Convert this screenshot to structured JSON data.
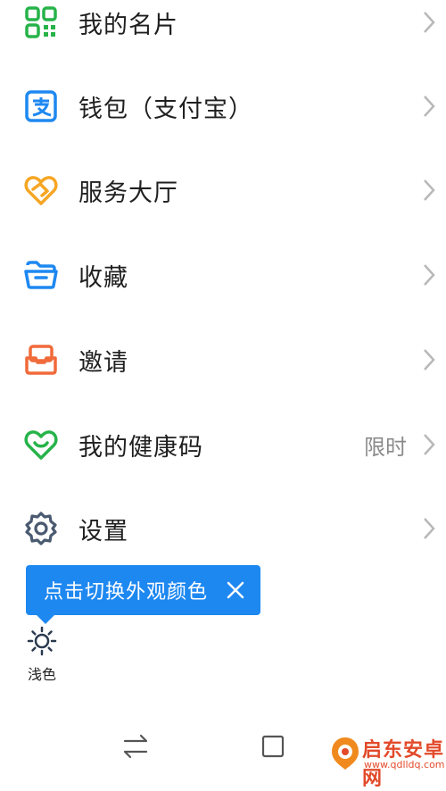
{
  "menu": {
    "items": [
      {
        "label": "我的名片",
        "icon": "qr-code-icon",
        "color": "#27b34a"
      },
      {
        "label": "钱包（支付宝）",
        "icon": "alipay-icon",
        "color": "#1e88f1"
      },
      {
        "label": "服务大厅",
        "icon": "heart-link-icon",
        "color": "#f5a623"
      },
      {
        "label": "收藏",
        "icon": "folder-icon",
        "color": "#1e88f1"
      },
      {
        "label": "邀请",
        "icon": "inbox-icon",
        "color": "#f06a3a"
      },
      {
        "label": "我的健康码",
        "icon": "health-heart-icon",
        "color": "#27b34a",
        "badge": "限时"
      },
      {
        "label": "设置",
        "icon": "gear-icon",
        "color": "#4a5a70"
      }
    ]
  },
  "tooltip": {
    "text": "点击切换外观颜色"
  },
  "theme": {
    "label": "浅色"
  },
  "nav": {
    "back": "switch-icon",
    "home": "square-icon"
  },
  "watermark": {
    "text": "启东安卓网",
    "url": "www.qdlldq.com"
  }
}
